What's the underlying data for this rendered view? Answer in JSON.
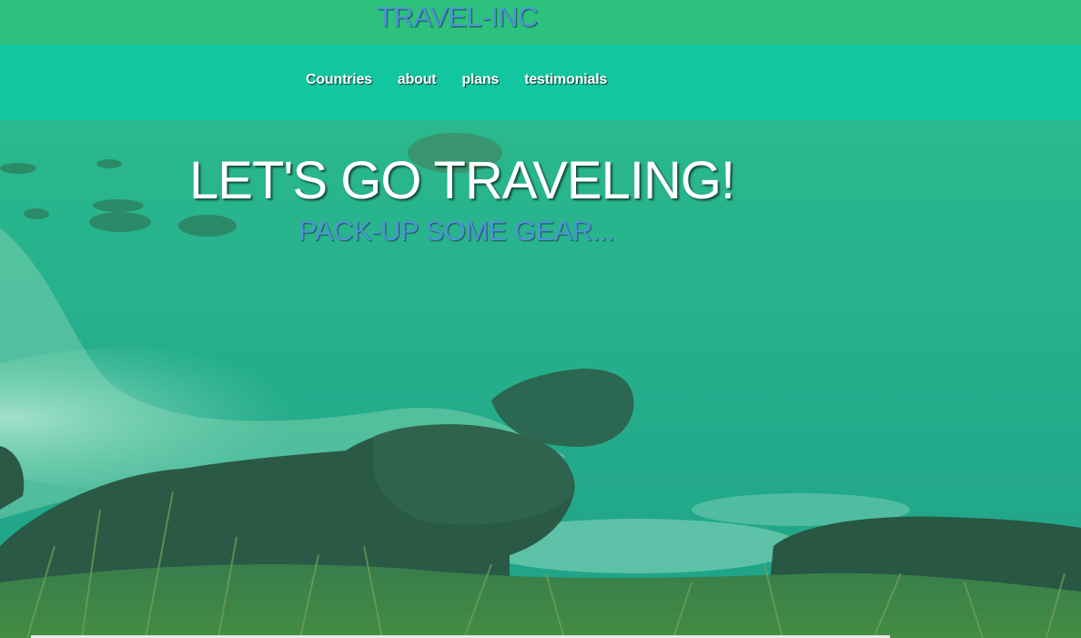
{
  "header": {
    "brand": "TRAVEL-INC"
  },
  "nav": {
    "items": [
      {
        "label": "Countries"
      },
      {
        "label": "about"
      },
      {
        "label": "plans"
      },
      {
        "label": "testimonials"
      }
    ]
  },
  "hero": {
    "title": "LET'S GO TRAVELING!",
    "subtitle": "PACK-UP SOME GEAR..."
  },
  "colors": {
    "header_bg": "#2dc17e",
    "nav_bg": "#10c8a0",
    "brand_text": "#4e93d3",
    "nav_text": "#ffffff",
    "hero_overlay": "#1fbf8f"
  }
}
